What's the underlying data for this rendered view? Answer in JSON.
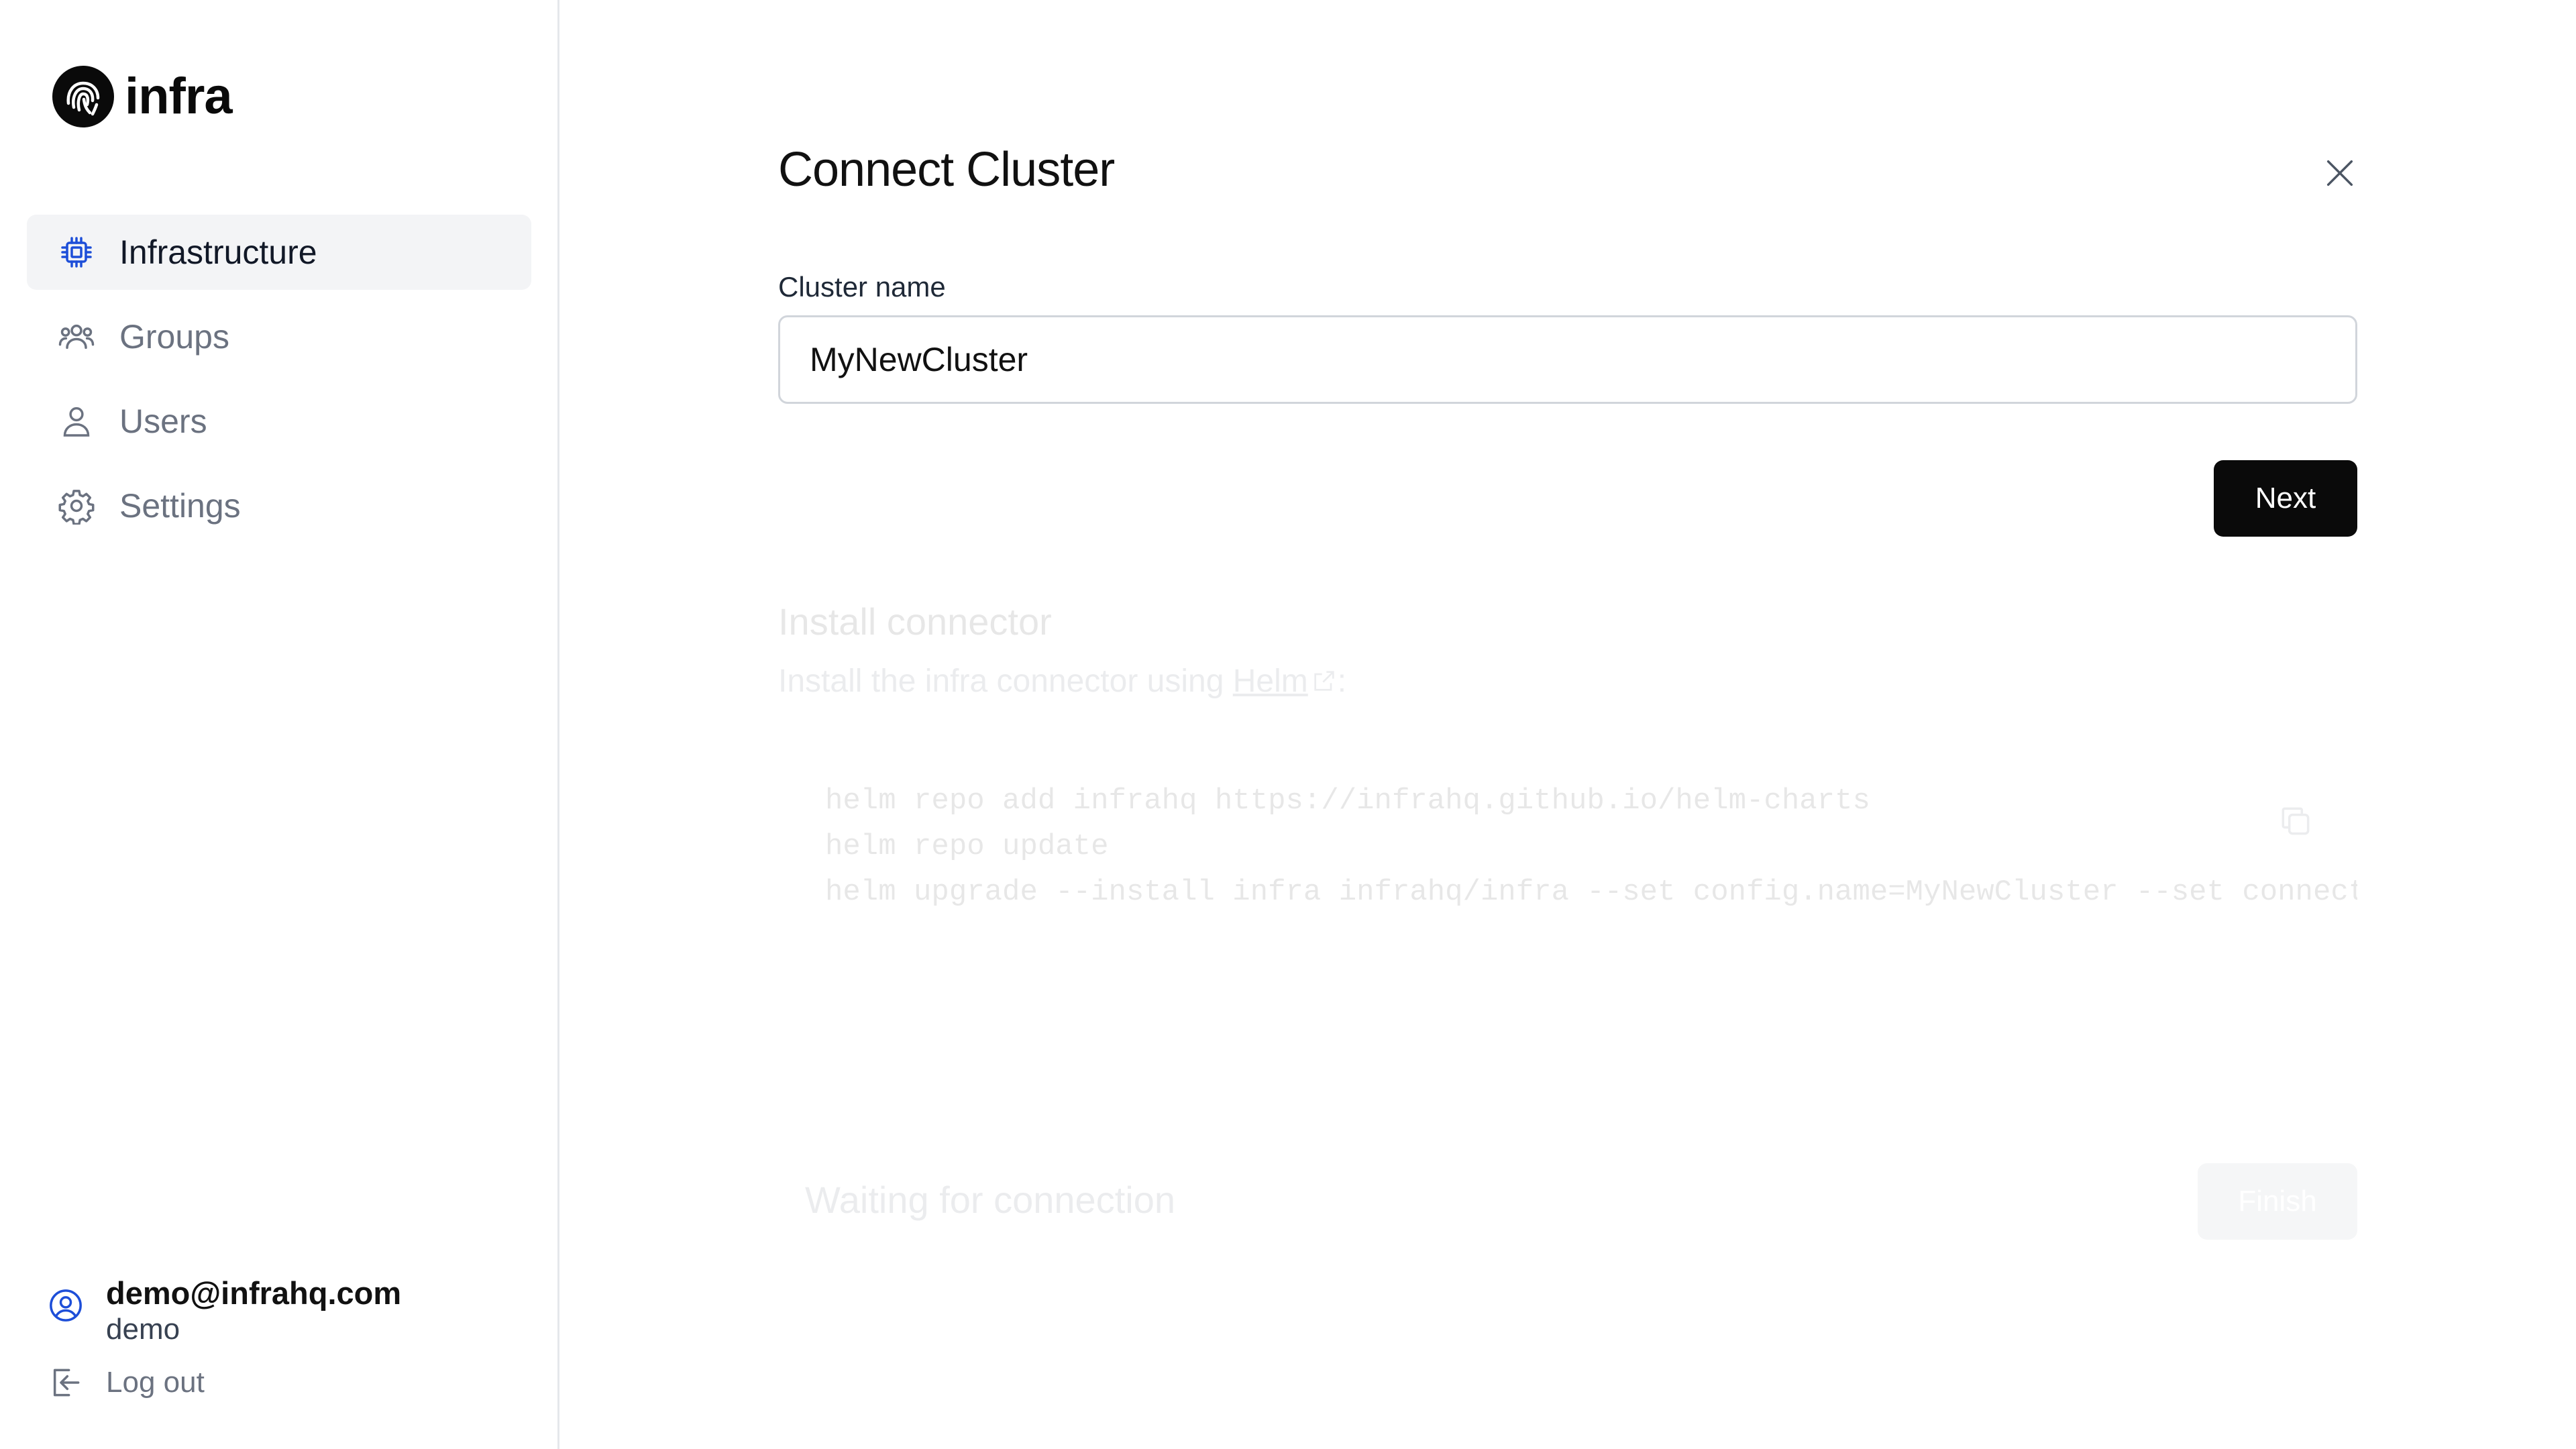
{
  "app": {
    "logo_text": "infra"
  },
  "sidebar": {
    "items": [
      {
        "label": "Infrastructure",
        "icon": "chip-icon",
        "active": true
      },
      {
        "label": "Groups",
        "icon": "groups-icon",
        "active": false
      },
      {
        "label": "Users",
        "icon": "user-icon",
        "active": false
      },
      {
        "label": "Settings",
        "icon": "gear-icon",
        "active": false
      }
    ],
    "user": {
      "email": "demo@infrahq.com",
      "name": "demo"
    },
    "logout_label": "Log out"
  },
  "modal": {
    "title": "Connect Cluster",
    "field_label": "Cluster name",
    "cluster_name_value": "MyNewCluster",
    "next_label": "Next",
    "install": {
      "title": "Install connector",
      "desc_prefix": "Install the infra connector using ",
      "desc_link": "Helm",
      "desc_suffix": ":",
      "code_lines": [
        "helm repo add infrahq https://infrahq.github.io/helm-charts",
        "helm repo update",
        "helm upgrade --install infra infrahq/infra  --set config.name=MyNewCluster --set connector.config.accessKey=..."
      ]
    },
    "waiting_label": "Waiting for connection",
    "finish_label": "Finish"
  },
  "colors": {
    "accent": "#1d4ed8",
    "primary_button": "#0a0a0a"
  }
}
